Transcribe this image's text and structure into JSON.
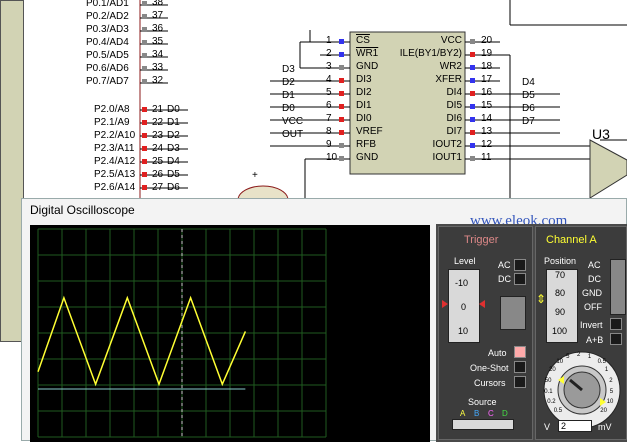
{
  "schematic": {
    "port0_labels": [
      "P0.1/AD1",
      "P0.2/AD2",
      "P0.3/AD3",
      "P0.4/AD4",
      "P0.5/AD5",
      "P0.6/AD6",
      "P0.7/AD7"
    ],
    "port0_pins": [
      "38",
      "37",
      "36",
      "35",
      "34",
      "33",
      "32"
    ],
    "port2_labels": [
      "P2.0/A8",
      "P2.1/A9",
      "P2.2/A10",
      "P2.3/A11",
      "P2.4/A12",
      "P2.5/A13",
      "P2.6/A14"
    ],
    "port2_pins": [
      "21",
      "22",
      "23",
      "24",
      "25",
      "26",
      "27"
    ],
    "port2_nets": [
      "D0",
      "D1",
      "D2",
      "D3",
      "D4",
      "D5",
      "D6"
    ],
    "dac_left_pins": [
      "1",
      "2",
      "3",
      "4",
      "5",
      "6",
      "7",
      "8",
      "9",
      "10"
    ],
    "dac_left_labels": [
      "CS",
      "WR1",
      "GND",
      "DI3",
      "DI2",
      "DI1",
      "DI0",
      "VREF",
      "RFB",
      "GND"
    ],
    "dac_left_nets": [
      "",
      "",
      "",
      "D3",
      "D2",
      "D1",
      "D0",
      "VCC",
      "OUT",
      ""
    ],
    "dac_right_pins": [
      "20",
      "19",
      "18",
      "17",
      "16",
      "15",
      "14",
      "13",
      "12",
      "11"
    ],
    "dac_right_labels": [
      "VCC",
      "ILE(BY1/BY2)",
      "",
      "WR2",
      "XFER",
      "DI4",
      "DI5",
      "DI6",
      "DI7",
      "IOUT2",
      "IOUT1"
    ],
    "dac_right_labels_fixed": [
      "VCC",
      "ILE(BY1/BY2)",
      "WR2",
      "XFER",
      "DI4",
      "DI5",
      "DI6",
      "DI7",
      "IOUT2",
      "IOUT1"
    ],
    "dac_right_nets": [
      "",
      "",
      "",
      "",
      "D4",
      "D5",
      "D6",
      "D7",
      "",
      ""
    ],
    "opamp_label": "U3",
    "plus_sign": "+"
  },
  "watermark": "www.eleok.com",
  "oscilloscope": {
    "title": "Digital Oscilloscope",
    "trigger": {
      "header": "Trigger",
      "level_label": "Level",
      "dial_ticks": [
        "-10",
        "0",
        "10"
      ],
      "ac": "AC",
      "dc": "DC",
      "auto": "Auto",
      "one_shot": "One-Shot",
      "cursors": "Cursors",
      "source_label": "Source",
      "sources": [
        "A",
        "B",
        "C",
        "D"
      ]
    },
    "channel_a": {
      "header": "Channel A",
      "position_label": "Position",
      "position_ticks": [
        "70",
        "80",
        "90",
        "100"
      ],
      "ac": "AC",
      "dc": "DC",
      "gnd": "GND",
      "off": "OFF",
      "invert": "Invert",
      "a_plus_b": "A+B",
      "knob_ticks": [
        "0.5",
        "0.2",
        "0.1",
        "50",
        "20",
        "10",
        "5",
        "2",
        "1",
        "0.5",
        "1",
        "2",
        "5",
        "10",
        "20"
      ],
      "volt_unit": "V",
      "volt_value": "2",
      "mv_unit": "mV"
    },
    "colors": {
      "trace_a": "#ffff33",
      "trace_b": "#88cccc",
      "grid": "#1f5a1f",
      "screen": "#000000"
    },
    "waveform": {
      "type": "triangle",
      "points": [
        [
          0,
          0.18
        ],
        [
          0.09,
          0.95
        ],
        [
          0.2,
          0.05
        ],
        [
          0.31,
          0.95
        ],
        [
          0.42,
          0.05
        ],
        [
          0.53,
          0.95
        ],
        [
          0.64,
          0.05
        ],
        [
          0.72,
          0.6
        ]
      ]
    }
  }
}
